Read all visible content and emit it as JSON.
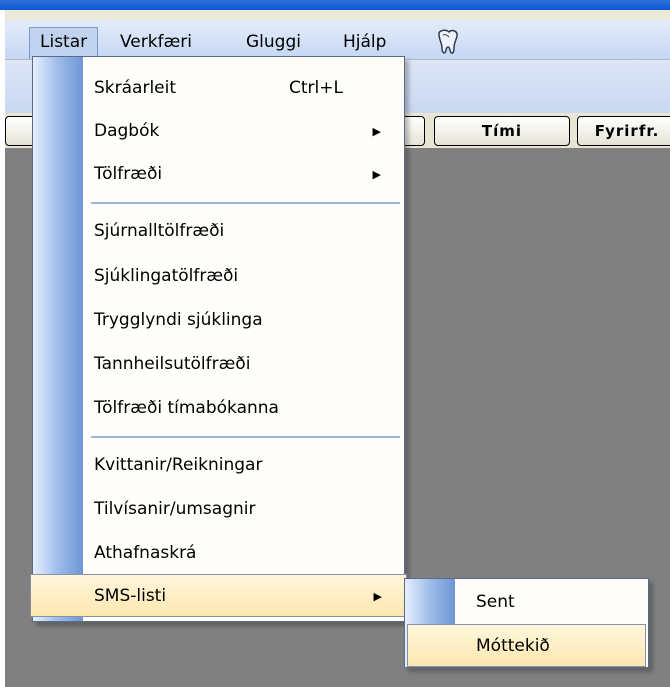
{
  "menubar": {
    "items": [
      {
        "label": "Listar",
        "active": true
      },
      {
        "label": "Verkfæri"
      },
      {
        "label": "Gluggi"
      },
      {
        "label": "Hjálp"
      }
    ],
    "help_icon": "tooth-help-icon"
  },
  "columns": {
    "headers": [
      "",
      "Tími",
      "Fyrirfr."
    ]
  },
  "listar_menu": {
    "items": [
      {
        "label": "Skráarleit",
        "shortcut": "Ctrl+L"
      },
      {
        "label": "Dagbók",
        "submenu": true
      },
      {
        "label": "Tölfræði",
        "submenu": true
      },
      {
        "label": "Sjúrnalltölfræði"
      },
      {
        "label": "Sjúklingatölfræði"
      },
      {
        "label": "Trygglyndi sjúklinga"
      },
      {
        "label": "Tannheilsutölfræði"
      },
      {
        "label": "Tölfræði tímabókanna"
      },
      {
        "label": "Kvittanir/Reikningar"
      },
      {
        "label": "Tilvísanir/umsagnir"
      },
      {
        "label": "Athafnaskrá"
      },
      {
        "label": "SMS-listi",
        "submenu": true,
        "highlighted": true
      }
    ]
  },
  "sms_submenu": {
    "items": [
      {
        "label": "Sent"
      },
      {
        "label": "Móttekið",
        "highlighted": true
      }
    ]
  },
  "colors": {
    "menu_highlight": "#fde7b0",
    "menubar": "#c6d7f3",
    "workspace": "#808080",
    "gutter": "#6e95d6"
  }
}
